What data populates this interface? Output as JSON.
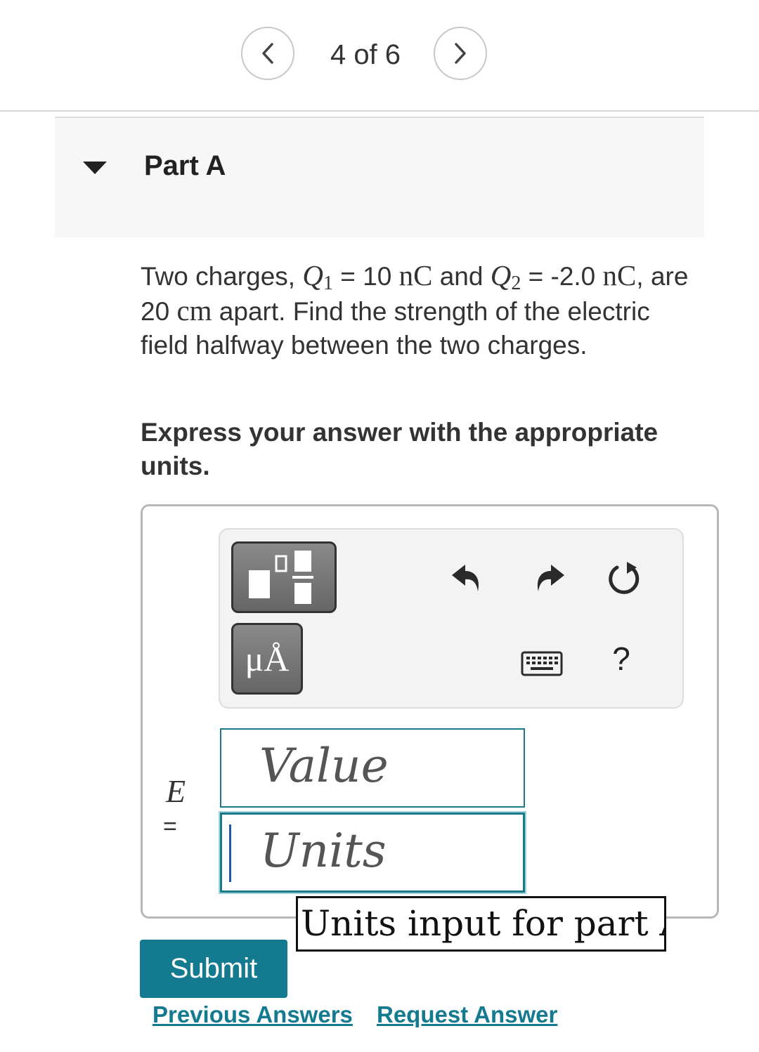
{
  "pagination": {
    "text": "4 of 6",
    "prev_icon": "chevron-left-icon",
    "next_icon": "chevron-right-icon"
  },
  "part": {
    "title": "Part A",
    "collapse_icon": "caret-down-icon"
  },
  "question": {
    "t1": "Two charges, ",
    "q1_sym": "Q",
    "q1_sub": "1",
    "t2": " = 10 ",
    "u1": "nC",
    "t3": " and ",
    "q2_sym": "Q",
    "q2_sub": "2",
    "t4": " = -2.0 ",
    "u2": "nC",
    "t5": ", are 20 ",
    "u3": "cm",
    "t6": " apart. Find the strength of the electric field halfway between the two charges."
  },
  "instruction": "Express your answer with the appropriate units.",
  "toolbar": {
    "template_icon": "fraction-template-icon",
    "units_label": "μÅ",
    "undo_icon": "undo-icon",
    "redo_icon": "redo-icon",
    "reset_icon": "reset-icon",
    "keyboard_icon": "keyboard-icon",
    "help_label": "?"
  },
  "answer": {
    "variable": "E",
    "equals": "=",
    "value_placeholder": "Value",
    "units_placeholder": "Units",
    "units_tooltip": "Units input for part A"
  },
  "actions": {
    "submit": "Submit",
    "previous_answers": "Previous Answers",
    "request_answer": "Request Answer"
  },
  "colors": {
    "accent": "#137a8f",
    "tool_button": "#777777",
    "part_header_bg": "#f7f7f7"
  }
}
